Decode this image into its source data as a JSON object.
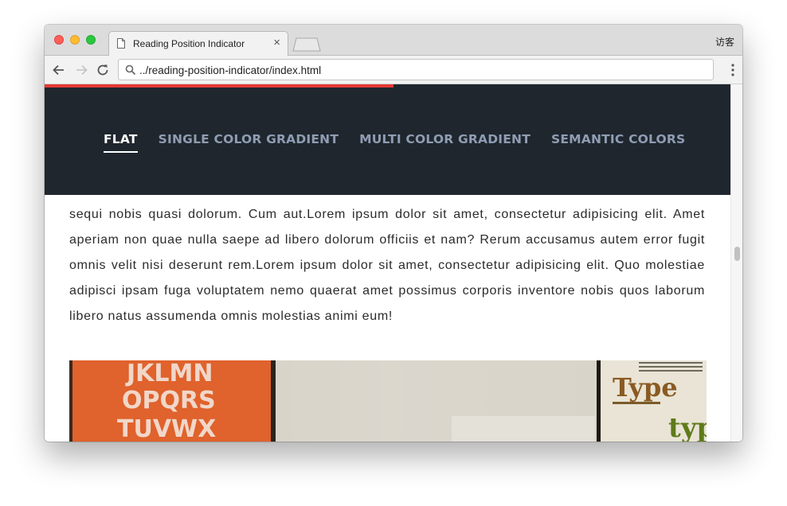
{
  "browser": {
    "tab_title": "Reading Position Indicator",
    "tab_close": "×",
    "visitor_label": "访客",
    "url": "../reading-position-indicator/index.html"
  },
  "progress": {
    "fraction": 0.5,
    "color": "#e53935"
  },
  "nav": {
    "items": [
      {
        "label": "FLAT",
        "active": true
      },
      {
        "label": "SINGLE COLOR GRADIENT",
        "active": false
      },
      {
        "label": "MULTI COLOR GRADIENT",
        "active": false
      },
      {
        "label": "SEMANTIC COLORS",
        "active": false
      }
    ]
  },
  "article": {
    "paragraph_main": "sequi nobis quasi dolorum. Cum aut.Lorem ipsum dolor sit amet, consectetur adipisicing elit. Amet aperiam non quae nulla saepe ad libero dolorum officiis et nam? Rerum accusamus autem error fugit omnis velit nisi deserunt rem.Lorem ipsum dolor sit amet, consectetur adipisicing elit. Quo molestiae adipisci ipsam fuga voluptatem nemo quaerat amet possimus corporis inventore nobis quos laborum libero natus assumenda omnis molestias animi eum!",
    "photo_poster_text": "JKLMN OPQRS TUVWXYZ",
    "photo_book_title_1": "Type",
    "photo_book_title_2": "typ"
  },
  "colors": {
    "header_bg": "#1f262e",
    "nav_inactive": "#8f9db3",
    "nav_active": "#ffffff"
  }
}
